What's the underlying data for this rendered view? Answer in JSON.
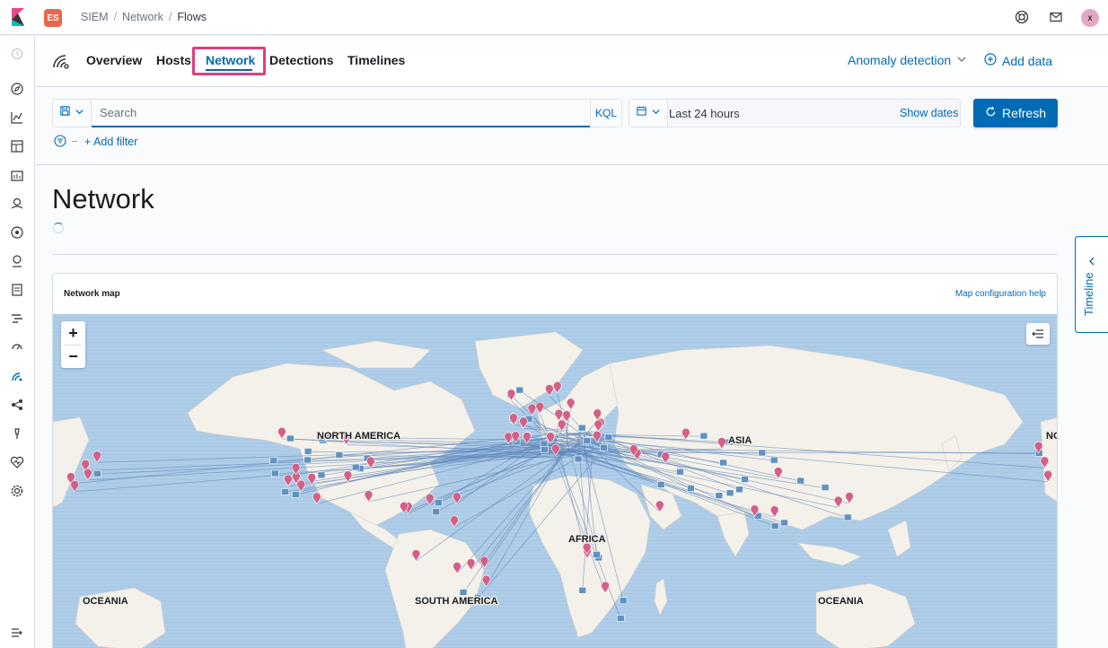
{
  "header": {
    "space_initials": "ES",
    "breadcrumbs": [
      "SIEM",
      "Network",
      "Flows"
    ],
    "user_initial": "x"
  },
  "app_nav": {
    "tabs": [
      {
        "label": "Overview",
        "active": false
      },
      {
        "label": "Hosts",
        "active": false
      },
      {
        "label": "Network",
        "active": true
      },
      {
        "label": "Detections",
        "active": false
      },
      {
        "label": "Timelines",
        "active": false
      }
    ],
    "anomaly_detection_label": "Anomaly detection",
    "add_data_label": "Add data"
  },
  "query_bar": {
    "search_placeholder": "Search",
    "language_label": "KQL",
    "date_range_label": "Last 24 hours",
    "show_dates_label": "Show dates",
    "refresh_label": "Refresh",
    "add_filter_label": "+ Add filter"
  },
  "page": {
    "title": "Network"
  },
  "map_panel": {
    "title": "Network map",
    "help_link": "Map configuration help",
    "zoom_in_label": "+",
    "zoom_out_label": "−",
    "continent_labels": [
      "NORTH AMERICA",
      "ASIA",
      "AFRICA",
      "SOUTH AMERICA",
      "OCEANIA",
      "OCEANIA",
      "NORTH AMERICA"
    ],
    "marker_colors": {
      "source": "#d36086",
      "destination": "#6092c0"
    }
  },
  "timeline_flyout": {
    "label": "Timeline"
  },
  "colors": {
    "accent": "#006bb4",
    "highlight": "#dd3f7e",
    "ocean": "#a9c9e6",
    "land": "#f4f1ea"
  }
}
